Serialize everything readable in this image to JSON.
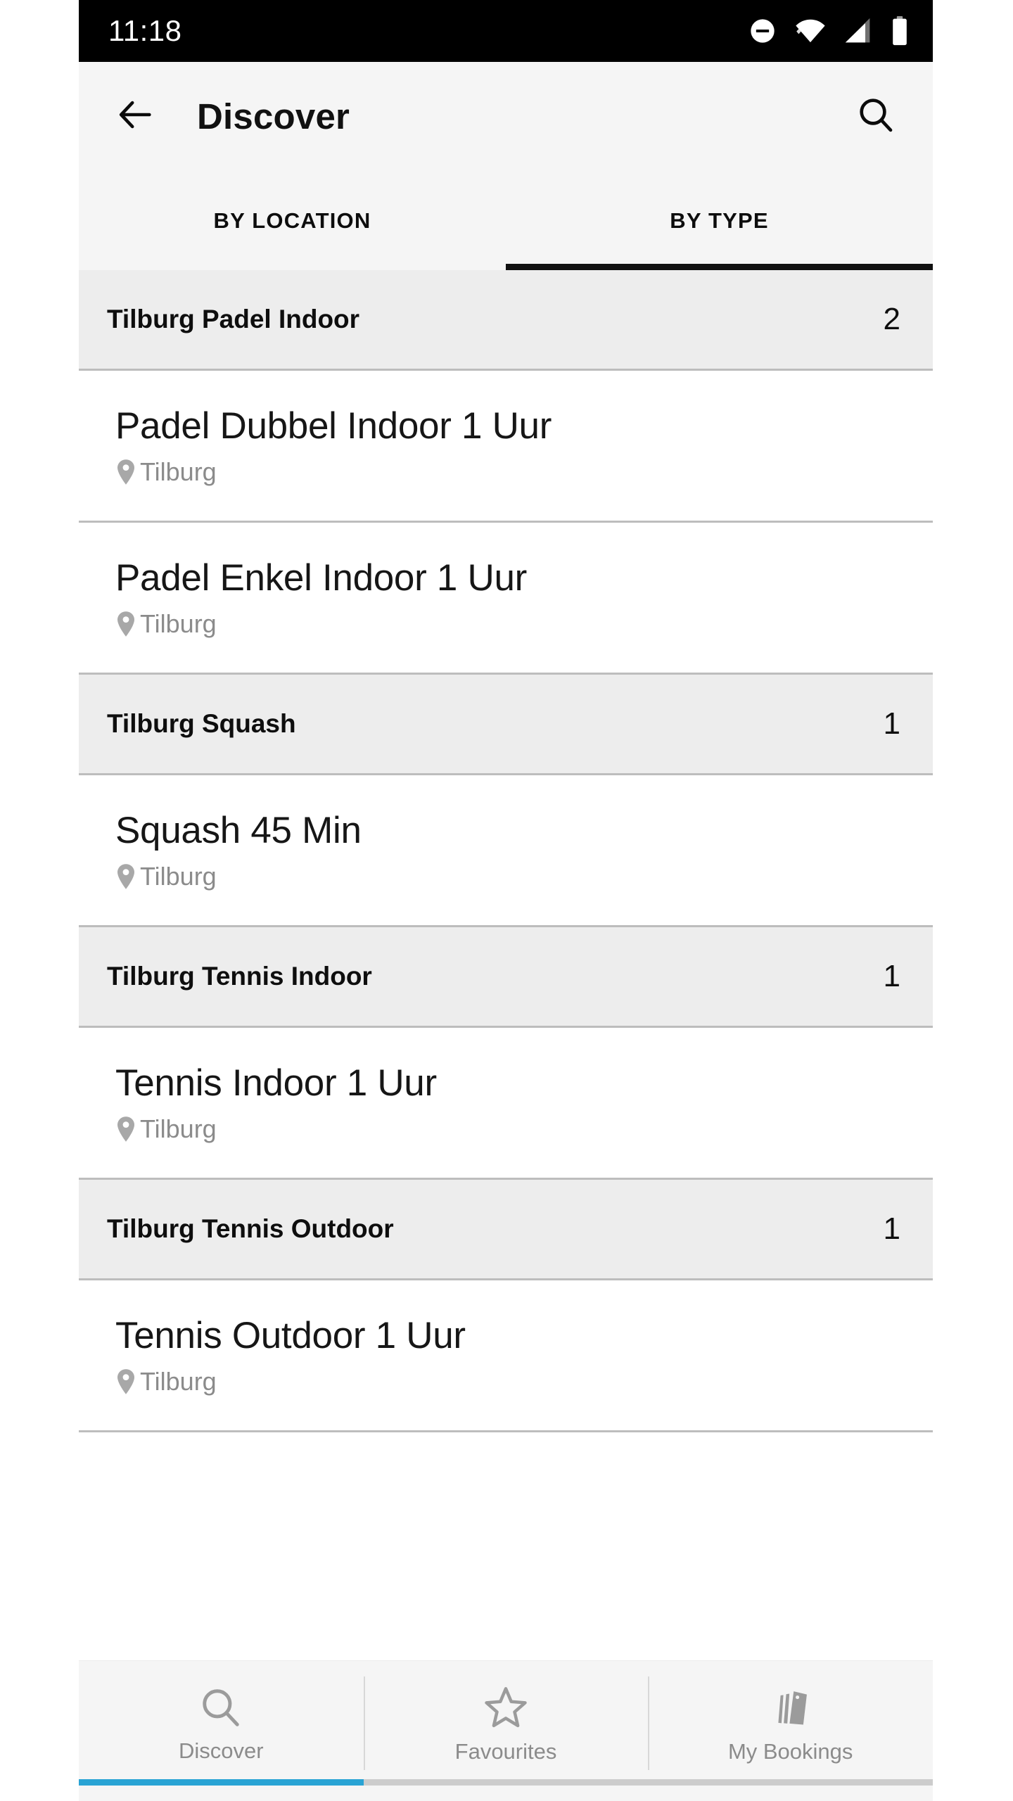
{
  "status_bar": {
    "time": "11:18",
    "icons": [
      "do-not-disturb-icon",
      "wifi-icon",
      "cellular-signal-icon",
      "battery-icon"
    ]
  },
  "app_bar": {
    "back_icon": "back-arrow-icon",
    "title": "Discover",
    "search_icon": "search-icon"
  },
  "tabs": [
    {
      "label": "BY LOCATION",
      "active": false
    },
    {
      "label": "BY TYPE",
      "active": true
    }
  ],
  "groups": [
    {
      "title": "Tilburg Padel Indoor",
      "count": "2",
      "items": [
        {
          "title": "Padel Dubbel Indoor 1 Uur",
          "location": "Tilburg",
          "location_icon": "location-pin-icon"
        },
        {
          "title": "Padel Enkel Indoor 1 Uur",
          "location": "Tilburg",
          "location_icon": "location-pin-icon"
        }
      ]
    },
    {
      "title": "Tilburg Squash",
      "count": "1",
      "items": [
        {
          "title": "Squash 45 Min",
          "location": "Tilburg",
          "location_icon": "location-pin-icon"
        }
      ]
    },
    {
      "title": "Tilburg Tennis Indoor",
      "count": "1",
      "items": [
        {
          "title": "Tennis Indoor 1 Uur",
          "location": "Tilburg",
          "location_icon": "location-pin-icon"
        }
      ]
    },
    {
      "title": "Tilburg Tennis Outdoor",
      "count": "1",
      "items": [
        {
          "title": "Tennis Outdoor 1 Uur",
          "location": "Tilburg",
          "location_icon": "location-pin-icon"
        }
      ]
    }
  ],
  "bottom_nav": {
    "items": [
      {
        "label": "Discover",
        "icon": "search-icon",
        "active": true
      },
      {
        "label": "Favourites",
        "icon": "star-icon",
        "active": false
      },
      {
        "label": "My Bookings",
        "icon": "cards-icon",
        "active": false
      }
    ]
  },
  "colors": {
    "accent": "#29a3d4",
    "app_bar_bg": "#f5f5f5",
    "group_header_bg": "#ededed",
    "tab_indicator": "#111111",
    "muted_text": "#8b8b8b",
    "status_bar_bg": "#000000"
  }
}
